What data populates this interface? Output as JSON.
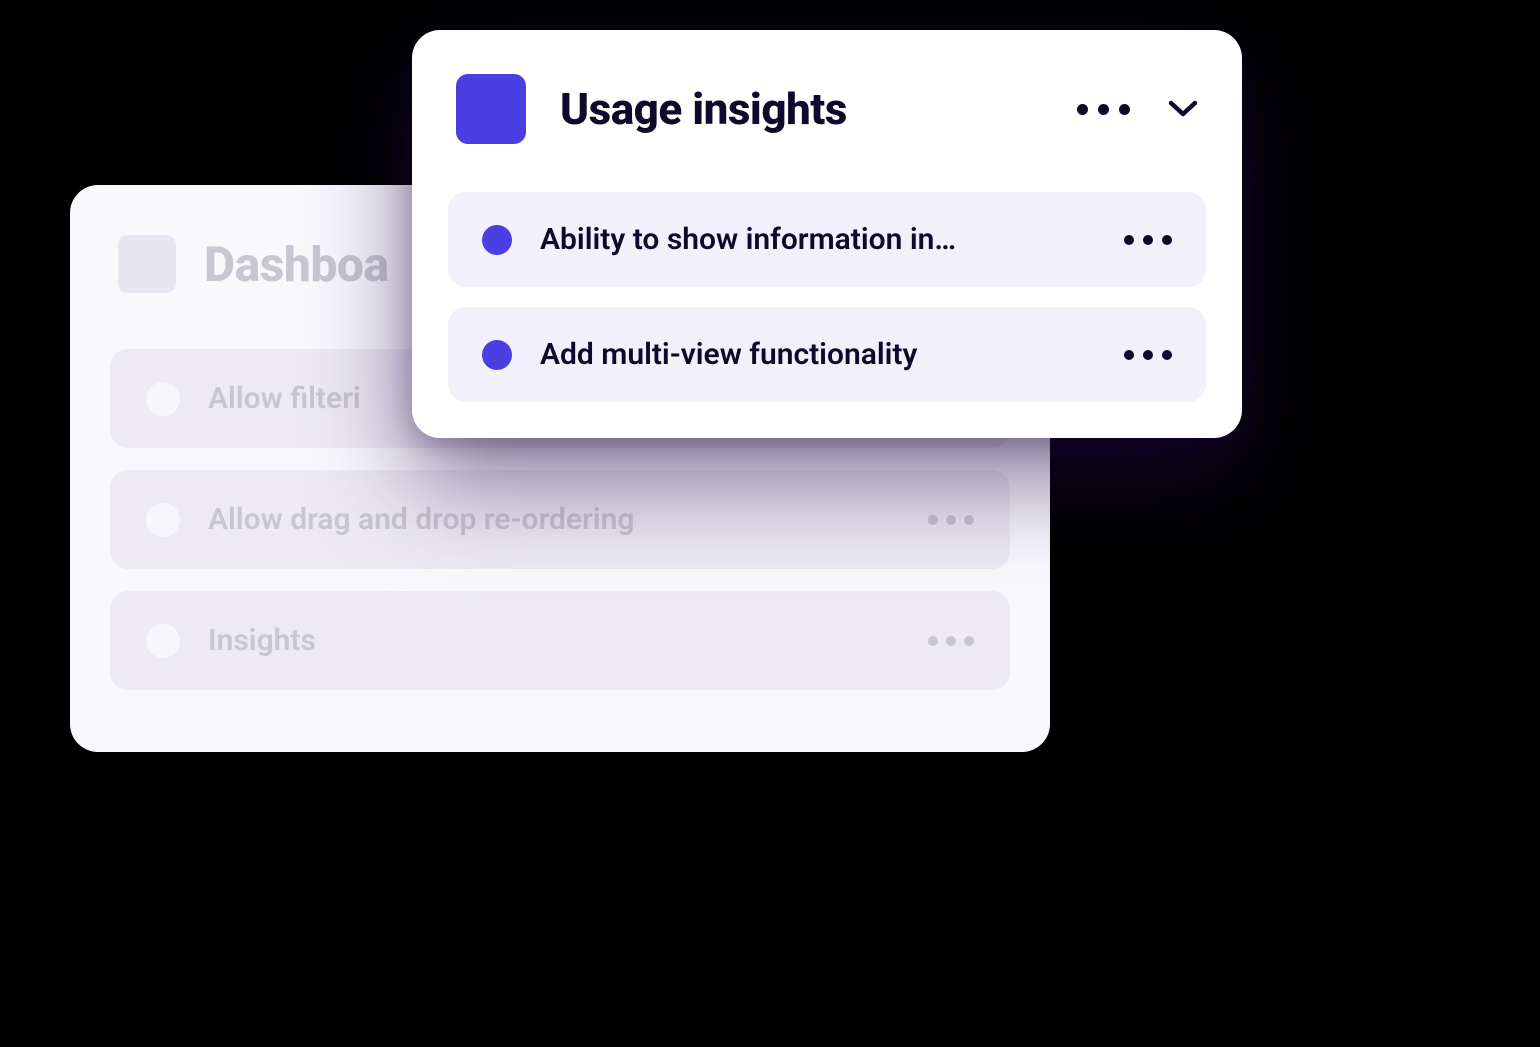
{
  "back_card": {
    "title": "Dashboa",
    "items": [
      {
        "label": "Allow filteri"
      },
      {
        "label": "Allow drag and drop re-ordering"
      },
      {
        "label": "Insights"
      }
    ]
  },
  "front_card": {
    "title": "Usage insights",
    "swatch_color": "#4a3fe0",
    "items": [
      {
        "label": "Ability to show information in…"
      },
      {
        "label": "Add multi-view functionality"
      }
    ]
  }
}
